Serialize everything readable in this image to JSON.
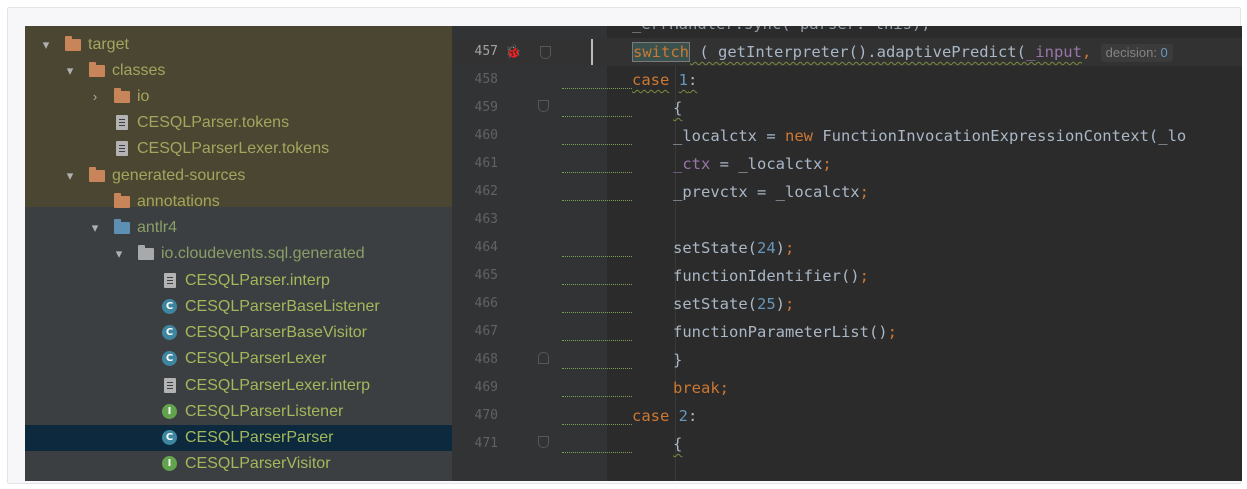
{
  "tree": {
    "items": [
      {
        "label": "target",
        "icon": "folder-icon",
        "chevron": "▾"
      },
      {
        "label": "classes",
        "icon": "folder-icon",
        "chevron": "▾"
      },
      {
        "label": "io",
        "icon": "folder-icon",
        "chevron": "›"
      },
      {
        "label": "CESQLParser.tokens",
        "icon": "file-text-icon"
      },
      {
        "label": "CESQLParserLexer.tokens",
        "icon": "file-text-icon"
      },
      {
        "label": "generated-sources",
        "icon": "folder-icon",
        "chevron": "▾"
      },
      {
        "label": "annotations",
        "icon": "folder-icon"
      },
      {
        "label": "antlr4",
        "icon": "source-root-folder-icon",
        "chevron": "▾"
      },
      {
        "label": "io.cloudevents.sql.generated",
        "icon": "package-icon",
        "chevron": "▾"
      },
      {
        "label": "CESQLParser.interp",
        "icon": "file-text-icon"
      },
      {
        "label": "CESQLParserBaseListener",
        "icon": "class-icon",
        "badge": "C"
      },
      {
        "label": "CESQLParserBaseVisitor",
        "icon": "class-icon",
        "badge": "C"
      },
      {
        "label": "CESQLParserLexer",
        "icon": "class-icon",
        "badge": "C"
      },
      {
        "label": "CESQLParserLexer.interp",
        "icon": "file-text-icon"
      },
      {
        "label": "CESQLParserListener",
        "icon": "interface-icon",
        "badge": "I"
      },
      {
        "label": "CESQLParserParser",
        "icon": "class-icon",
        "badge": "C"
      },
      {
        "label": "CESQLParserVisitor",
        "icon": "interface-icon",
        "badge": "I"
      }
    ]
  },
  "editor": {
    "line_numbers": [
      "457",
      "458",
      "459",
      "460",
      "461",
      "462",
      "463",
      "464",
      "465",
      "466",
      "467",
      "468",
      "469",
      "470",
      "471"
    ],
    "lines": {
      "l457": {
        "kw": "switch",
        "rest": " ( getInterpreter().adaptivePredict(",
        "fld": "_input",
        ", ": ", ",
        "hint": "decision: ",
        "hint_num": "0"
      },
      "l458": {
        "kw": "case",
        "num": "1",
        ":": ":"
      },
      "l459": {
        "text": "{"
      },
      "l460": {
        "a": "_localctx = ",
        "kw": "new",
        "b": " FunctionInvocationExpressionContext(_lo"
      },
      "l461": {
        "fld": "_ctx",
        "b": " = _localctx",
        ";": ";"
      },
      "l462": {
        "a": "_prevctx = _localctx",
        ";": ";"
      },
      "l464": {
        "a": "setState(",
        "num": "24",
        ")": ")",
        ";": ";"
      },
      "l465": {
        "a": "functionIdentifier()",
        ";": ";"
      },
      "l466": {
        "a": "setState(",
        "num": "25",
        ")": ")",
        ";": ";"
      },
      "l467": {
        "a": "functionParameterList()",
        ";": ";"
      },
      "l468": {
        "text": "}"
      },
      "l469": {
        "kw": "break",
        ";": ";"
      },
      "l470": {
        "kw": "case",
        "num": "2",
        ":": ":"
      },
      "l471": {
        "text": "{"
      }
    },
    "top_partial_text": "_errHandler.sync( parser: this);",
    "gutter_icons": {
      "debug": "bug-icon"
    }
  },
  "colors": {
    "tree_bg": "#3c3f41",
    "editor_bg": "#2b2b2b",
    "keyword": "#cc7832",
    "number": "#6897bb",
    "field": "#9876aa",
    "selection": "#0d293e"
  }
}
